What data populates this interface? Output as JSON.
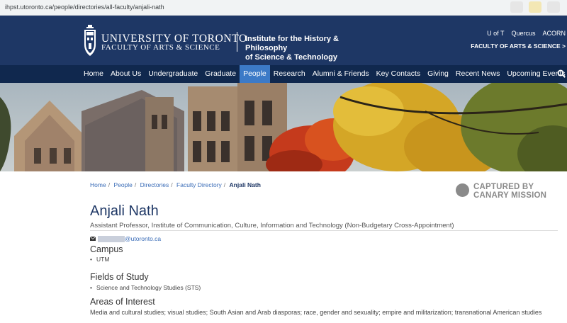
{
  "browser": {
    "url": "ihpst.utoronto.ca/people/directories/all-faculty/anjali-nath"
  },
  "header": {
    "university_name": "UNIVERSITY OF TORONTO",
    "faculty_name": "FACULTY OF ARTS & SCIENCE",
    "institute_line1": "Institute for the History & Philosophy",
    "institute_line2": "of Science & Technology",
    "top_links": [
      "U of T",
      "Quercus",
      "ACORN"
    ],
    "faculty_link": "FACULTY OF ARTS & SCIENCE >"
  },
  "nav": {
    "items": [
      {
        "label": "Home"
      },
      {
        "label": "About Us"
      },
      {
        "label": "Undergraduate"
      },
      {
        "label": "Graduate"
      },
      {
        "label": "People"
      },
      {
        "label": "Research"
      },
      {
        "label": "Alumni & Friends"
      },
      {
        "label": "Key Contacts"
      },
      {
        "label": "Giving"
      },
      {
        "label": "Recent News"
      },
      {
        "label": "Upcoming Events"
      }
    ],
    "active_index": 4
  },
  "breadcrumb": {
    "items": [
      "Home",
      "People",
      "Directories",
      "Faculty Directory"
    ],
    "current": "Anjali Nath"
  },
  "stamp": {
    "line1": "CAPTURED BY",
    "line2": "CANARY MISSION"
  },
  "profile": {
    "name": "Anjali Nath",
    "title": "Assistant Professor, Institute of Communication, Culture, Information and Technology (Non-Budgetary Cross-Appointment)",
    "email_domain": "@utoronto.ca",
    "campus_heading": "Campus",
    "campus": [
      "UTM"
    ],
    "fields_heading": "Fields of Study",
    "fields": [
      "Science and Technology Studies (STS)"
    ],
    "interests_heading": "Areas of Interest",
    "interests": "Media and cultural studies; visual studies; South Asian and Arab diasporas; race, gender and sexuality; empire and militarization; transnational American studies"
  },
  "colors": {
    "header_bg": "#1e3765",
    "nav_bg": "#10284e",
    "nav_active": "#3c7ac7",
    "link": "#3a6cb7"
  },
  "icons": {
    "search": "search-icon",
    "email": "envelope-icon",
    "crest": "crest-icon",
    "stamp": "stamp-icon"
  }
}
